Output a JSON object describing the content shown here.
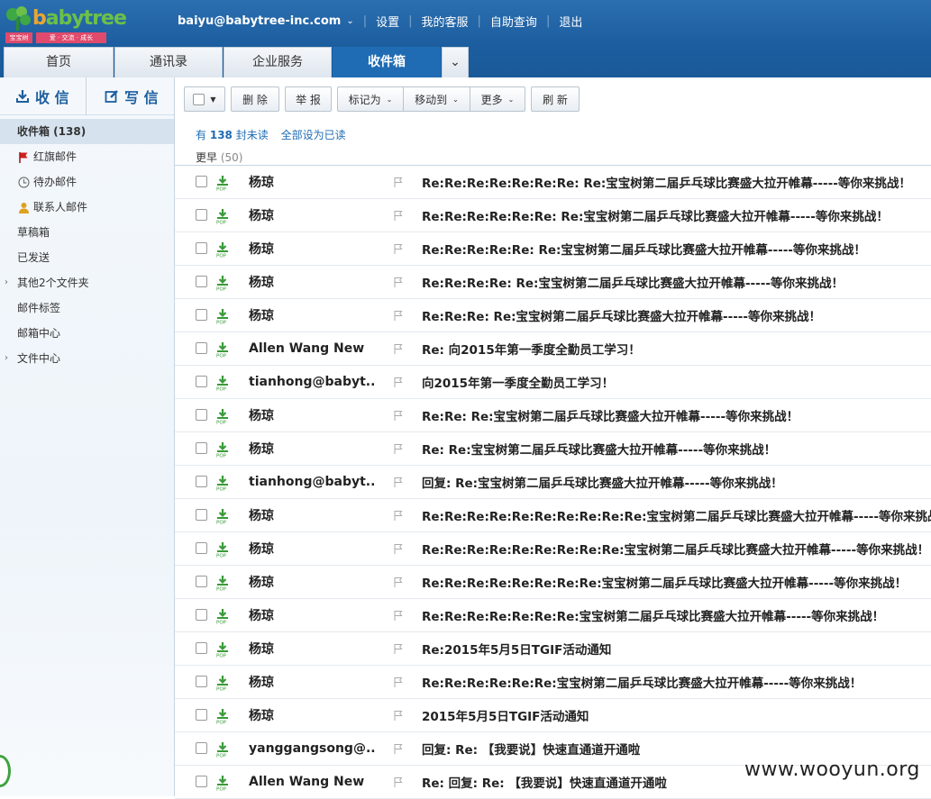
{
  "app": {
    "logo_text": "babytree",
    "logo_sub_left": "宝宝树",
    "logo_sub_right": "爱 · 交流 · 成长"
  },
  "top": {
    "account": "baiyu@babytree-inc.com",
    "links": [
      "设置",
      "我的客服",
      "自助查询",
      "退出"
    ]
  },
  "tabs": [
    "首页",
    "通讯录",
    "企业服务",
    "收件箱"
  ],
  "sidebar": {
    "receive": "收 信",
    "write": "写 信",
    "folders": [
      {
        "label": "收件箱 (138)",
        "icon": "none"
      },
      {
        "label": "红旗邮件",
        "icon": "red-flag-icon"
      },
      {
        "label": "待办邮件",
        "icon": "clock-icon"
      },
      {
        "label": "联系人邮件",
        "icon": "person-icon"
      },
      {
        "label": "草稿箱",
        "icon": "none"
      },
      {
        "label": "已发送",
        "icon": "none"
      },
      {
        "label": "其他2个文件夹",
        "icon": "expand-arrow-icon"
      },
      {
        "label": "邮件标签",
        "icon": "none"
      },
      {
        "label": "邮箱中心",
        "icon": "none"
      },
      {
        "label": "文件中心",
        "icon": "expand-arrow-icon"
      }
    ]
  },
  "toolbar": {
    "delete": "删 除",
    "report": "举 报",
    "mark_as": "标记为",
    "move_to": "移动到",
    "more": "更多",
    "refresh": "刷 新"
  },
  "status": {
    "unread_prefix": "有",
    "unread_count": "138",
    "unread_suffix": "封未读",
    "mark_all_read": "全部设为已读",
    "group_label": "更早",
    "group_count": "(50)"
  },
  "mails": [
    {
      "sender": "杨琼",
      "subject": "Re:Re:Re:Re:Re:Re:Re: Re:宝宝树第二届乒乓球比赛盛大拉开帷幕-----等你来挑战！"
    },
    {
      "sender": "杨琼",
      "subject": "Re:Re:Re:Re:Re:Re: Re:宝宝树第二届乒乓球比赛盛大拉开帷幕-----等你来挑战！"
    },
    {
      "sender": "杨琼",
      "subject": "Re:Re:Re:Re:Re: Re:宝宝树第二届乒乓球比赛盛大拉开帷幕-----等你来挑战！"
    },
    {
      "sender": "杨琼",
      "subject": "Re:Re:Re:Re: Re:宝宝树第二届乒乓球比赛盛大拉开帷幕-----等你来挑战！"
    },
    {
      "sender": "杨琼",
      "subject": "Re:Re:Re: Re:宝宝树第二届乒乓球比赛盛大拉开帷幕-----等你来挑战！"
    },
    {
      "sender": "Allen Wang New",
      "subject": "Re: 向2015年第一季度全勤员工学习！"
    },
    {
      "sender": "tianhong@babyt...",
      "subject": "向2015年第一季度全勤员工学习！"
    },
    {
      "sender": "杨琼",
      "subject": "Re:Re: Re:宝宝树第二届乒乓球比赛盛大拉开帷幕-----等你来挑战！"
    },
    {
      "sender": "杨琼",
      "subject": "Re: Re:宝宝树第二届乒乓球比赛盛大拉开帷幕-----等你来挑战！"
    },
    {
      "sender": "tianhong@babyt...",
      "subject": "回复: Re:宝宝树第二届乒乓球比赛盛大拉开帷幕-----等你来挑战！"
    },
    {
      "sender": "杨琼",
      "subject": "Re:Re:Re:Re:Re:Re:Re:Re:Re:Re:宝宝树第二届乒乓球比赛盛大拉开帷幕-----等你来挑战！"
    },
    {
      "sender": "杨琼",
      "subject": "Re:Re:Re:Re:Re:Re:Re:Re:Re:宝宝树第二届乒乓球比赛盛大拉开帷幕-----等你来挑战！"
    },
    {
      "sender": "杨琼",
      "subject": "Re:Re:Re:Re:Re:Re:Re:Re:宝宝树第二届乒乓球比赛盛大拉开帷幕-----等你来挑战！"
    },
    {
      "sender": "杨琼",
      "subject": "Re:Re:Re:Re:Re:Re:Re:宝宝树第二届乒乓球比赛盛大拉开帷幕-----等你来挑战！"
    },
    {
      "sender": "杨琼",
      "subject": "Re:2015年5月5日TGIF活动通知"
    },
    {
      "sender": "杨琼",
      "subject": "Re:Re:Re:Re:Re:Re:宝宝树第二届乒乓球比赛盛大拉开帷幕-----等你来挑战！"
    },
    {
      "sender": "杨琼",
      "subject": "2015年5月5日TGIF活动通知"
    },
    {
      "sender": "yanggangsong@...",
      "subject": "回复: Re: 【我要说】快速直通道开通啦"
    },
    {
      "sender": "Allen Wang New",
      "subject": "Re: 回复: Re: 【我要说】快速直通道开通啦"
    }
  ],
  "watermark": "www.wooyun.org",
  "colors": {
    "header": "#1b5d9e",
    "active_tab": "#1f6cb4",
    "pop_icon": "#3a9a3a",
    "flag": "#d0201e"
  }
}
